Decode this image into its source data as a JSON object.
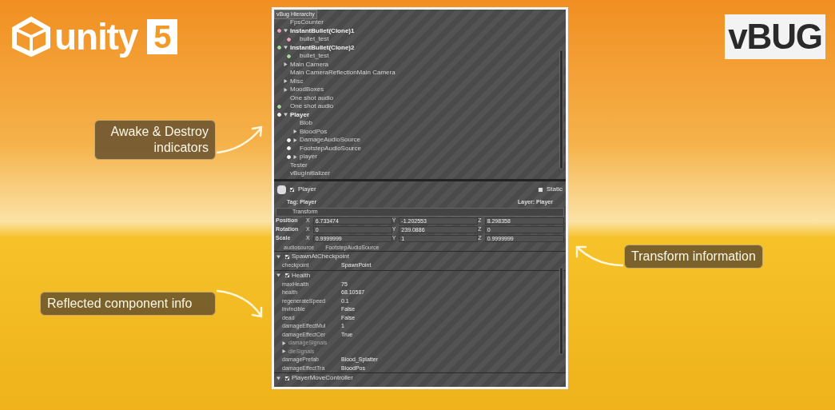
{
  "unity_logo": {
    "wordmark": "unity",
    "version": "5"
  },
  "vbug_logo": "vBUG",
  "callouts": {
    "awake_destroy": "Awake & Destroy indicators",
    "reflected": "Reflected component info",
    "transform": "Transform information"
  },
  "hierarchy": {
    "title": "vBug Hierarchy",
    "items": [
      {
        "name": "FpsCounter"
      },
      {
        "name": "InstantBullet(Clone)1",
        "bold": true,
        "expanded": true,
        "color": "#e8a6b6",
        "children": [
          {
            "name": "bullet_test",
            "color": "#e8a6b6"
          }
        ]
      },
      {
        "name": "InstantBullet(Clone)2",
        "bold": true,
        "expanded": true,
        "color": "#a8d8a0",
        "children": [
          {
            "name": "bullet_test",
            "color": "#a8d8a0"
          }
        ]
      },
      {
        "name": "Main Camera",
        "expanded": false
      },
      {
        "name": "Main CameraReflectionMain Camera"
      },
      {
        "name": "Misc",
        "expanded": false
      },
      {
        "name": "MoodBoxes",
        "expanded": false
      },
      {
        "name": "One shot audio"
      },
      {
        "name": "One shot audio",
        "color": "#a8d8a0"
      },
      {
        "name": "Player",
        "bold": true,
        "expanded": true,
        "color": "#f0f0f0",
        "children": [
          {
            "name": "Blob"
          },
          {
            "name": "BloodPos",
            "expanded": false
          },
          {
            "name": "DamageAudioSource",
            "expanded": false,
            "color": "#f0f0f0"
          },
          {
            "name": "FootstepAudioSource",
            "color": "#f0f0f0"
          },
          {
            "name": "player",
            "expanded": false,
            "color": "#f0f0f0"
          }
        ]
      },
      {
        "name": "Tester"
      },
      {
        "name": "vBugInitializer"
      }
    ]
  },
  "inspector": {
    "object": {
      "name": "Player",
      "checked": true
    },
    "static": {
      "label": "Static",
      "checked": false
    },
    "tag": "Tag: Player",
    "layer": "Layer: Player",
    "transform": {
      "title": "Transform",
      "rows": [
        {
          "label": "Position",
          "fields": [
            {
              "axis": "X",
              "value": "6.733474"
            },
            {
              "axis": "Y",
              "value": "-1.202553"
            },
            {
              "axis": "Z",
              "value": "8.298358"
            }
          ]
        },
        {
          "label": "Rotation",
          "fields": [
            {
              "axis": "X",
              "value": "0"
            },
            {
              "axis": "Y",
              "value": "239.0886"
            },
            {
              "axis": "Z",
              "value": "0"
            }
          ]
        },
        {
          "label": "Scale",
          "fields": [
            {
              "axis": "X",
              "value": "0.9999999"
            },
            {
              "axis": "Y",
              "value": "1"
            },
            {
              "axis": "Z",
              "value": "0.9999999"
            }
          ]
        }
      ]
    },
    "audio_row": {
      "label": "audiosource",
      "value": "FootstepAudioSource"
    },
    "components": [
      {
        "name": "SpawnAtCheckpoint",
        "checked": true,
        "expanded": true,
        "fields": [
          {
            "kind": "value",
            "label": "checkpoint",
            "value": "SpawnPoint"
          }
        ]
      },
      {
        "name": "Health",
        "checked": true,
        "expanded": true,
        "fields": [
          {
            "kind": "value",
            "label": "maxHealth",
            "value": "75"
          },
          {
            "kind": "value",
            "label": "health",
            "value": "68.10587"
          },
          {
            "kind": "value",
            "label": "regenerateSpeed",
            "value": "0.1"
          },
          {
            "kind": "value",
            "label": "invincible",
            "value": "False"
          },
          {
            "kind": "value",
            "label": "dead",
            "value": "False"
          },
          {
            "kind": "value",
            "label": "damageEffectMul",
            "value": "1"
          },
          {
            "kind": "value",
            "label": "damageEffectCer",
            "value": "True"
          },
          {
            "kind": "foldout",
            "label": "damageSignals",
            "expanded": false
          },
          {
            "kind": "foldout",
            "label": "dieSignals",
            "expanded": false
          },
          {
            "kind": "value",
            "label": "damagePrefab",
            "value": "Blood_Splatter"
          },
          {
            "kind": "value",
            "label": "damageEffectTra",
            "value": "BloodPos"
          }
        ]
      },
      {
        "name": "PlayerMoveController",
        "checked": true,
        "expanded": true
      }
    ]
  }
}
